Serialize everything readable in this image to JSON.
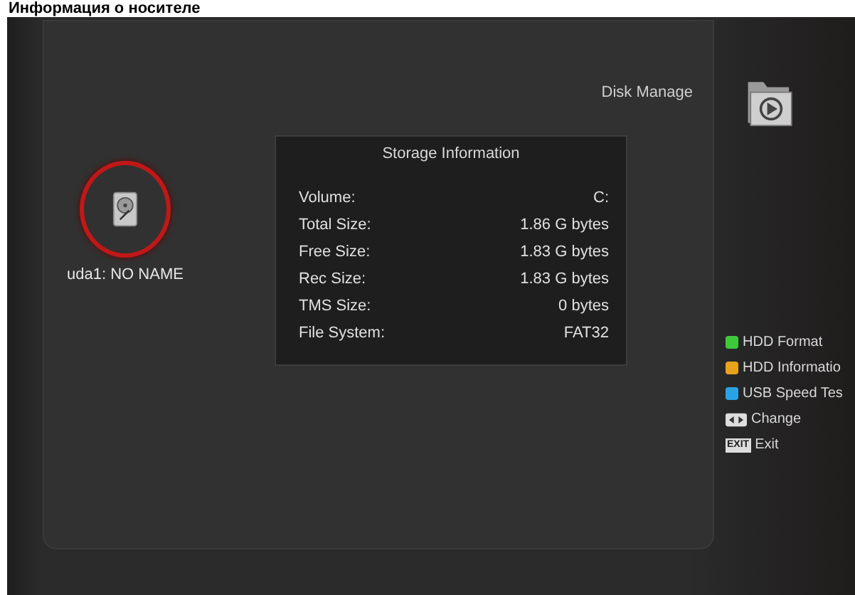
{
  "caption": "Информация о носителе",
  "menu_title": "Disk Manage",
  "device": {
    "label": "uda1: NO NAME",
    "selected": true
  },
  "storage": {
    "title": "Storage Information",
    "rows": [
      {
        "label": "Volume:",
        "value": "C:"
      },
      {
        "label": "Total Size:",
        "value": "1.86 G bytes"
      },
      {
        "label": "Free Size:",
        "value": "1.83 G bytes"
      },
      {
        "label": "Rec Size:",
        "value": "1.83 G bytes"
      },
      {
        "label": "TMS Size:",
        "value": "0 bytes"
      },
      {
        "label": "File System:",
        "value": "FAT32"
      }
    ]
  },
  "legend": [
    {
      "kind": "color",
      "color": "#3ec93a",
      "label": "HDD Format"
    },
    {
      "kind": "color",
      "color": "#e9a21c",
      "label": "HDD Informatio"
    },
    {
      "kind": "color",
      "color": "#2aa3e6",
      "label": "USB Speed Tes"
    },
    {
      "kind": "arrows",
      "label": "Change"
    },
    {
      "kind": "key",
      "key": "EXIT",
      "label": "Exit"
    }
  ]
}
